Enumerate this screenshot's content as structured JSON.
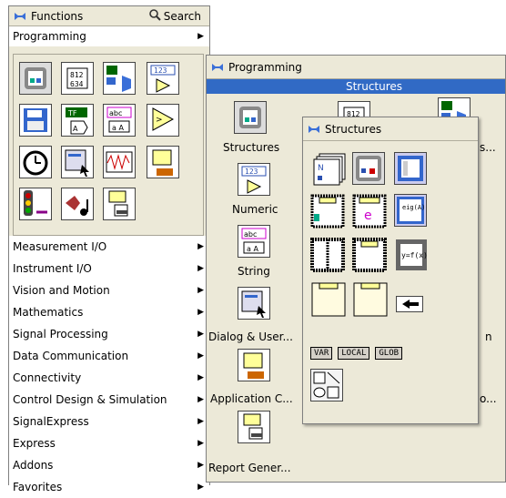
{
  "functions_palette": {
    "title": "Functions",
    "search_label": "Search",
    "programming_label": "Programming",
    "categories": [
      "Measurement I/O",
      "Instrument I/O",
      "Vision and Motion",
      "Mathematics",
      "Signal Processing",
      "Data Communication",
      "Connectivity",
      "Control Design & Simulation",
      "SignalExpress",
      "Express",
      "Addons",
      "Favorites"
    ]
  },
  "programming_palette": {
    "title": "Programming",
    "selected": "Structures",
    "items": [
      "Structures",
      "Numeric",
      "String",
      "Dialog & User...",
      "Application C...",
      "Report Gener..."
    ],
    "partial_right": [
      "s...",
      "n",
      "o..."
    ]
  },
  "structures_palette": {
    "title": "Structures",
    "tags": [
      "VAR",
      "LOCAL",
      "GLOB"
    ]
  }
}
